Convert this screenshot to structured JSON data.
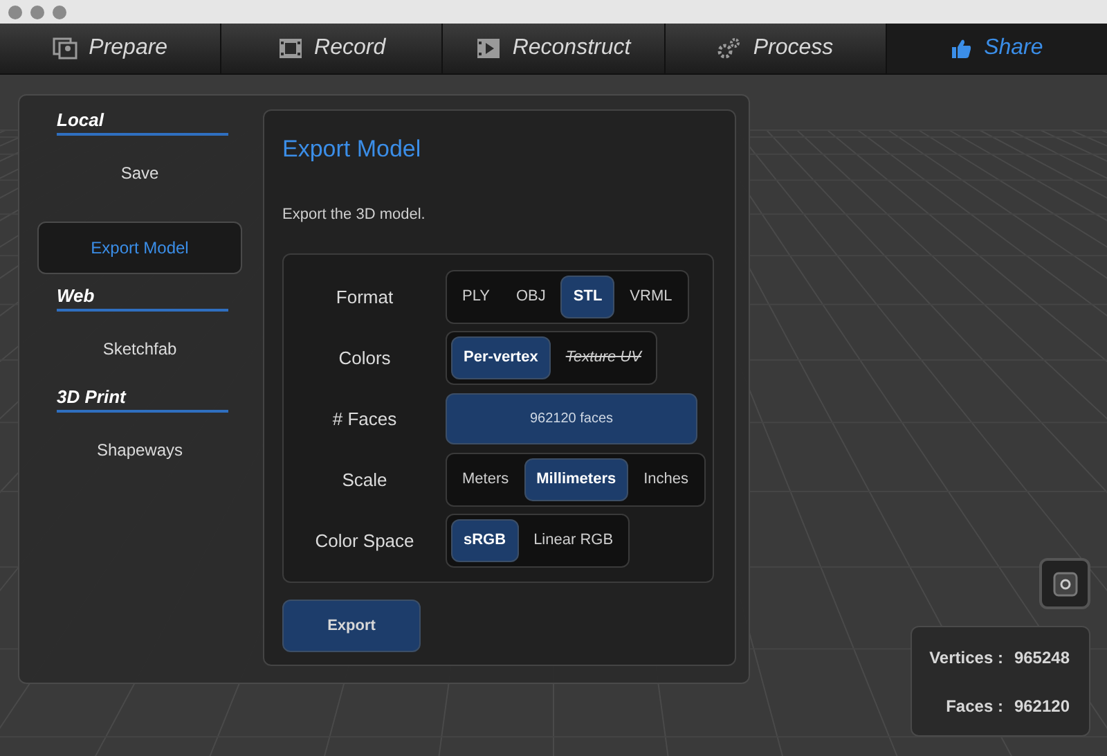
{
  "steps": [
    {
      "label": "Prepare",
      "kind": "photos",
      "selected": false
    },
    {
      "label": "Record",
      "kind": "film",
      "selected": false
    },
    {
      "label": "Reconstruct",
      "kind": "play",
      "selected": false
    },
    {
      "label": "Process",
      "kind": "gears",
      "selected": false
    },
    {
      "label": "Share",
      "kind": "thumb",
      "selected": true
    }
  ],
  "sidebar": {
    "sections": [
      {
        "heading": "Local",
        "items": [
          {
            "label": "Save",
            "selected": false
          },
          {
            "label": "Export Model",
            "selected": true
          }
        ]
      },
      {
        "heading": "Web",
        "items": [
          {
            "label": "Sketchfab",
            "selected": false
          }
        ]
      },
      {
        "heading": "3D Print",
        "items": [
          {
            "label": "Shapeways",
            "selected": false
          }
        ]
      }
    ]
  },
  "panel": {
    "title": "Export Model",
    "description": "Export the 3D model.",
    "settings": [
      {
        "label": "Format",
        "kind": "options",
        "options": [
          {
            "label": "PLY",
            "selected": false,
            "disabled": false
          },
          {
            "label": "OBJ",
            "selected": false,
            "disabled": false
          },
          {
            "label": "STL",
            "selected": true,
            "disabled": false
          },
          {
            "label": "VRML",
            "selected": false,
            "disabled": false
          }
        ]
      },
      {
        "label": "Colors",
        "kind": "options",
        "options": [
          {
            "label": "Per-vertex",
            "selected": true,
            "disabled": false
          },
          {
            "label": "Texture UV",
            "selected": false,
            "disabled": true
          }
        ]
      },
      {
        "label": "# Faces",
        "kind": "value",
        "value": "962120 faces"
      },
      {
        "label": "Scale",
        "kind": "options",
        "options": [
          {
            "label": "Meters",
            "selected": false,
            "disabled": false
          },
          {
            "label": "Millimeters",
            "selected": true,
            "disabled": false
          },
          {
            "label": "Inches",
            "selected": false,
            "disabled": false
          }
        ]
      },
      {
        "label": "Color Space",
        "kind": "options",
        "options": [
          {
            "label": "sRGB",
            "selected": true,
            "disabled": false
          },
          {
            "label": "Linear RGB",
            "selected": false,
            "disabled": false
          }
        ]
      }
    ],
    "button": "Export"
  },
  "stats": [
    {
      "label": "Vertices :",
      "value": "965248"
    },
    {
      "label": "Faces :",
      "value": "962120"
    }
  ]
}
